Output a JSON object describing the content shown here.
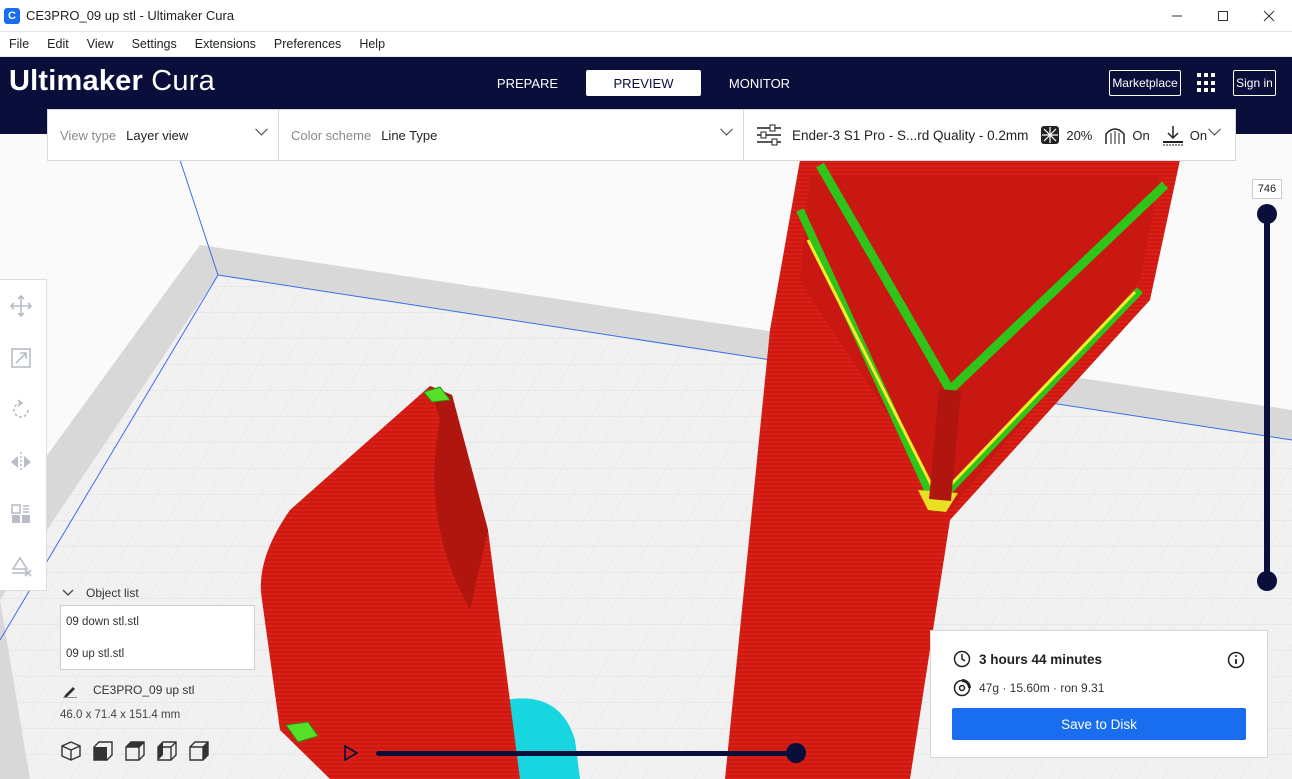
{
  "window": {
    "app_icon": "C",
    "title": "CE3PRO_09 up stl - Ultimaker Cura",
    "minimize_icon": "minimize-icon",
    "maximize_icon": "maximize-icon",
    "close_icon": "close-icon"
  },
  "menu": [
    "File",
    "Edit",
    "View",
    "Settings",
    "Extensions",
    "Preferences",
    "Help"
  ],
  "header": {
    "logo_bold": "Ultimaker",
    "logo_light": " Cura",
    "tabs": [
      "PREPARE",
      "PREVIEW",
      "MONITOR"
    ],
    "active_tab": "PREVIEW",
    "marketplace_label": "Marketplace",
    "signin_label": "Sign in",
    "accent_color": "#0a0e3a"
  },
  "settings_bar": {
    "view_type_label": "View type",
    "view_type_value": "Layer view",
    "color_scheme_label": "Color scheme",
    "color_scheme_value": "Line Type",
    "printer_profile": "Ender-3 S1 Pro - S...rd Quality - 0.2mm",
    "infill": "20%",
    "support": "On",
    "adhesion": "On"
  },
  "tools": [
    "move-tool-icon",
    "scale-tool-icon",
    "rotate-tool-icon",
    "mirror-tool-icon",
    "per-model-settings-icon",
    "support-blocker-icon"
  ],
  "object_list": {
    "header": "Object list",
    "items": [
      "09 down stl.stl",
      "09 up stl.stl"
    ],
    "current_name": "CE3PRO_09 up stl",
    "dimensions": "46.0 x 71.4 x 151.4 mm"
  },
  "layer_slider": {
    "current_layer": "746"
  },
  "output": {
    "print_time": "3 hours 44 minutes",
    "material_info": "47g · 15.60m · ron 9.31",
    "save_label": "Save to Disk",
    "button_color": "#196ef0"
  }
}
